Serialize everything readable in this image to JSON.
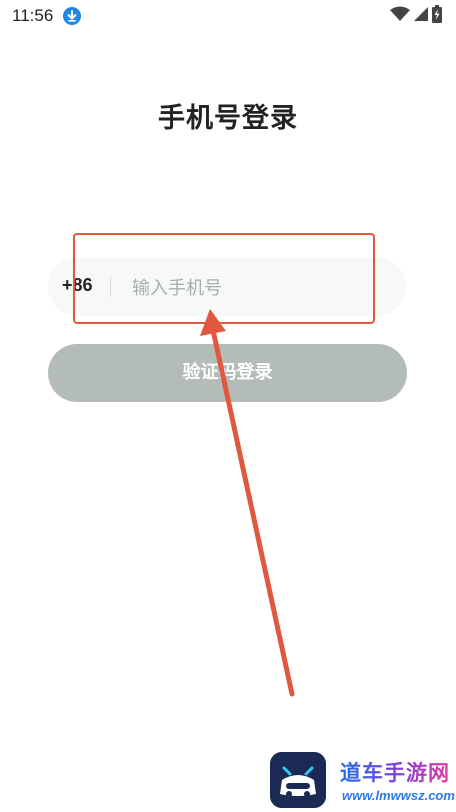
{
  "status_bar": {
    "time": "11:56",
    "download_icon": "download-icon",
    "wifi_icon": "wifi-icon",
    "signal_icon": "signal-icon",
    "battery_icon": "battery-charging-icon"
  },
  "page": {
    "title": "手机号登录"
  },
  "phone_form": {
    "country_code": "+86",
    "phone_placeholder": "输入手机号",
    "phone_value": "",
    "submit_label": "验证码登录"
  },
  "annotation": {
    "highlight_color": "#e0583f"
  },
  "watermark": {
    "title": "道车手游网",
    "url": "www.lmwwsz.com"
  },
  "colors": {
    "button_disabled": "#b3bcb6",
    "input_background": "#f7f8f8",
    "accent_blue": "#1e88e5"
  }
}
